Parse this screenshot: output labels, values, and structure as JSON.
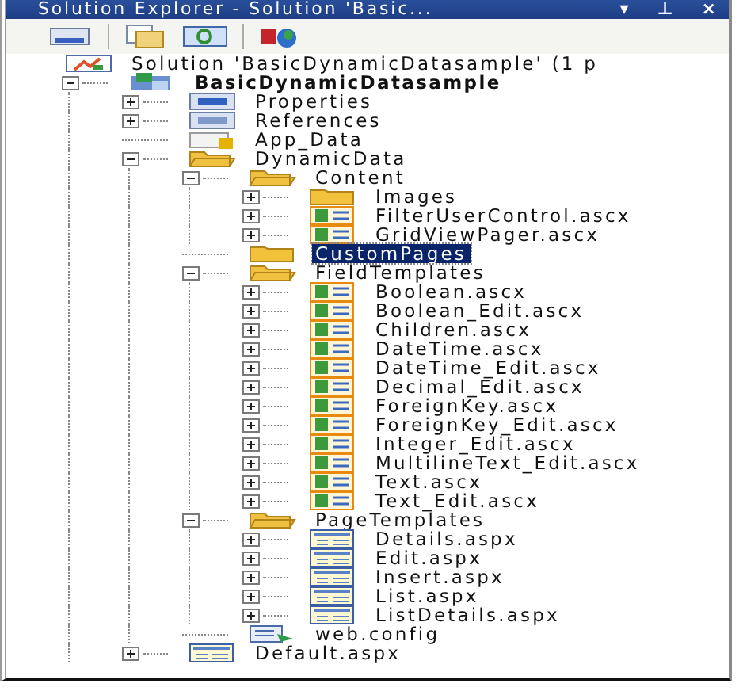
{
  "window": {
    "title": "Solution Explorer - Solution 'Basic...",
    "controls": [
      "▾",
      "⊥",
      "×"
    ]
  },
  "toolbar": [
    {
      "kind": "properties"
    },
    {
      "kind": "show-all"
    },
    {
      "kind": "refresh"
    },
    {
      "kind": "class-diagram"
    }
  ],
  "tree": [
    {
      "label": "Solution 'BasicDynamicDatasample' (1 p",
      "kind": "solution",
      "selected": false,
      "children": [
        {
          "label": "BasicDynamicDatasample",
          "kind": "project",
          "expanded": true,
          "selected": false,
          "children": [
            {
              "label": "Properties",
              "kind": "properties",
              "expanded": false,
              "selected": false
            },
            {
              "label": "References",
              "kind": "references",
              "expanded": false,
              "selected": false
            },
            {
              "label": "App_Data",
              "kind": "data-folder",
              "selected": false
            },
            {
              "label": "DynamicData",
              "kind": "folder",
              "expanded": true,
              "selected": false,
              "children": [
                {
                  "label": "Content",
                  "kind": "folder",
                  "expanded": true,
                  "selected": false,
                  "children": [
                    {
                      "label": "Images",
                      "kind": "folder",
                      "expanded": false,
                      "selected": false
                    },
                    {
                      "label": "FilterUserControl.ascx",
                      "kind": "control",
                      "expanded": false,
                      "selected": false
                    },
                    {
                      "label": "GridViewPager.ascx",
                      "kind": "control",
                      "expanded": false,
                      "selected": false
                    }
                  ]
                },
                {
                  "label": "CustomPages",
                  "kind": "folder",
                  "selected": true
                },
                {
                  "label": "FieldTemplates",
                  "kind": "folder",
                  "expanded": true,
                  "selected": false,
                  "children": [
                    {
                      "label": "Boolean.ascx",
                      "kind": "control",
                      "expanded": false,
                      "selected": false
                    },
                    {
                      "label": "Boolean_Edit.ascx",
                      "kind": "control",
                      "expanded": false,
                      "selected": false
                    },
                    {
                      "label": "Children.ascx",
                      "kind": "control",
                      "expanded": false,
                      "selected": false
                    },
                    {
                      "label": "DateTime.ascx",
                      "kind": "control",
                      "expanded": false,
                      "selected": false
                    },
                    {
                      "label": "DateTime_Edit.ascx",
                      "kind": "control",
                      "expanded": false,
                      "selected": false
                    },
                    {
                      "label": "Decimal_Edit.ascx",
                      "kind": "control",
                      "expanded": false,
                      "selected": false
                    },
                    {
                      "label": "ForeignKey.ascx",
                      "kind": "control",
                      "expanded": false,
                      "selected": false
                    },
                    {
                      "label": "ForeignKey_Edit.ascx",
                      "kind": "control",
                      "expanded": false,
                      "selected": false
                    },
                    {
                      "label": "Integer_Edit.ascx",
                      "kind": "control",
                      "expanded": false,
                      "selected": false
                    },
                    {
                      "label": "MultilineText_Edit.ascx",
                      "kind": "control",
                      "expanded": false,
                      "selected": false
                    },
                    {
                      "label": "Text.ascx",
                      "kind": "control",
                      "expanded": false,
                      "selected": false
                    },
                    {
                      "label": "Text_Edit.ascx",
                      "kind": "control",
                      "expanded": false,
                      "selected": false
                    }
                  ]
                },
                {
                  "label": "PageTemplates",
                  "kind": "folder",
                  "expanded": true,
                  "selected": false,
                  "children": [
                    {
                      "label": "Details.aspx",
                      "kind": "page",
                      "expanded": false,
                      "selected": false
                    },
                    {
                      "label": "Edit.aspx",
                      "kind": "page",
                      "expanded": false,
                      "selected": false
                    },
                    {
                      "label": "Insert.aspx",
                      "kind": "page",
                      "expanded": false,
                      "selected": false
                    },
                    {
                      "label": "List.aspx",
                      "kind": "page",
                      "expanded": false,
                      "selected": false
                    },
                    {
                      "label": "ListDetails.aspx",
                      "kind": "page",
                      "expanded": false,
                      "selected": false
                    }
                  ]
                },
                {
                  "label": "web.config",
                  "kind": "config",
                  "selected": false
                }
              ]
            },
            {
              "label": "Default.aspx",
              "kind": "page",
              "expanded": false,
              "selected": false
            }
          ]
        }
      ]
    }
  ]
}
